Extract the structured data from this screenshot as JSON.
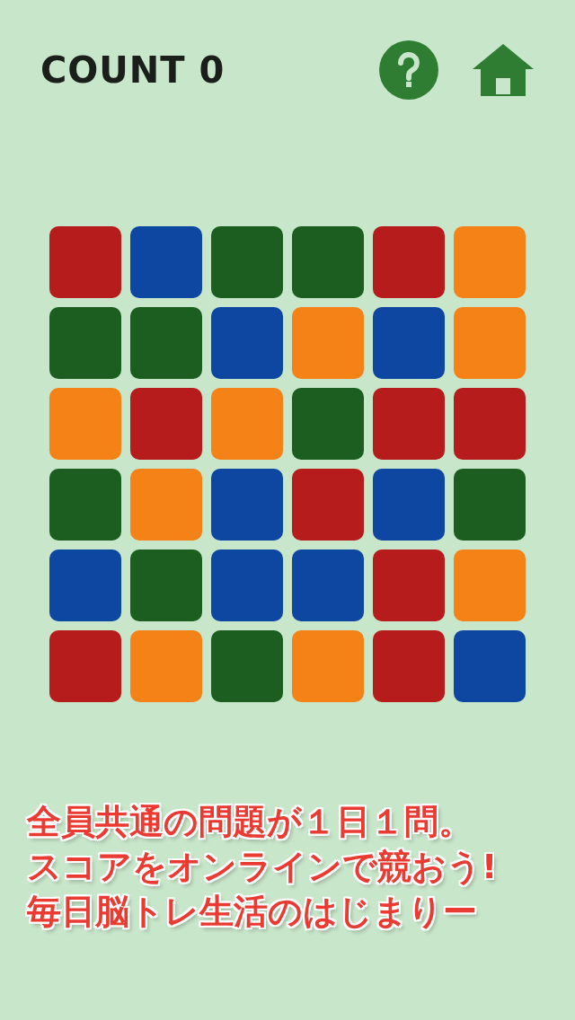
{
  "header": {
    "count_label": "COUNT",
    "count": "0"
  },
  "grid": [
    [
      {
        "color": "#b71c1c"
      },
      {
        "color": "#0d47a1"
      },
      {
        "color": "#1b5e20"
      },
      {
        "color": "#1b5e20"
      },
      {
        "color": "#b71c1c"
      },
      {
        "color": "#f58216"
      }
    ],
    [
      {
        "color": "#1b5e20"
      },
      {
        "color": "#1b5e20"
      },
      {
        "color": "#0d47a1"
      },
      {
        "color": "#f58216"
      },
      {
        "color": "#0d47a1"
      },
      {
        "color": "#f58216"
      }
    ],
    [
      {
        "color": "#f58216"
      },
      {
        "color": "#b71c1c"
      },
      {
        "color": "#f58216"
      },
      {
        "color": "#1b5e20"
      },
      {
        "color": "#b71c1c"
      },
      {
        "color": "#b71c1c"
      }
    ],
    [
      {
        "color": "#1b5e20"
      },
      {
        "color": "#f58216"
      },
      {
        "color": "#0d47a1"
      },
      {
        "color": "#b71c1c"
      },
      {
        "color": "#0d47a1"
      },
      {
        "color": "#1b5e20"
      }
    ],
    [
      {
        "color": "#0d47a1"
      },
      {
        "color": "#1b5e20"
      },
      {
        "color": "#0d47a1"
      },
      {
        "color": "#0d47a1"
      },
      {
        "color": "#b71c1c"
      },
      {
        "color": "#f58216"
      }
    ],
    [
      {
        "color": "#b71c1c"
      },
      {
        "color": "#f58216"
      },
      {
        "color": "#1b5e20"
      },
      {
        "color": "#f58216"
      },
      {
        "color": "#b71c1c"
      },
      {
        "color": "#0d47a1"
      }
    ]
  ],
  "promo_lines": [
    "全員共通の問題が１日１問。",
    "スコアをオンラインで競おう!",
    "毎日脳トレ生活のはじまりー"
  ]
}
